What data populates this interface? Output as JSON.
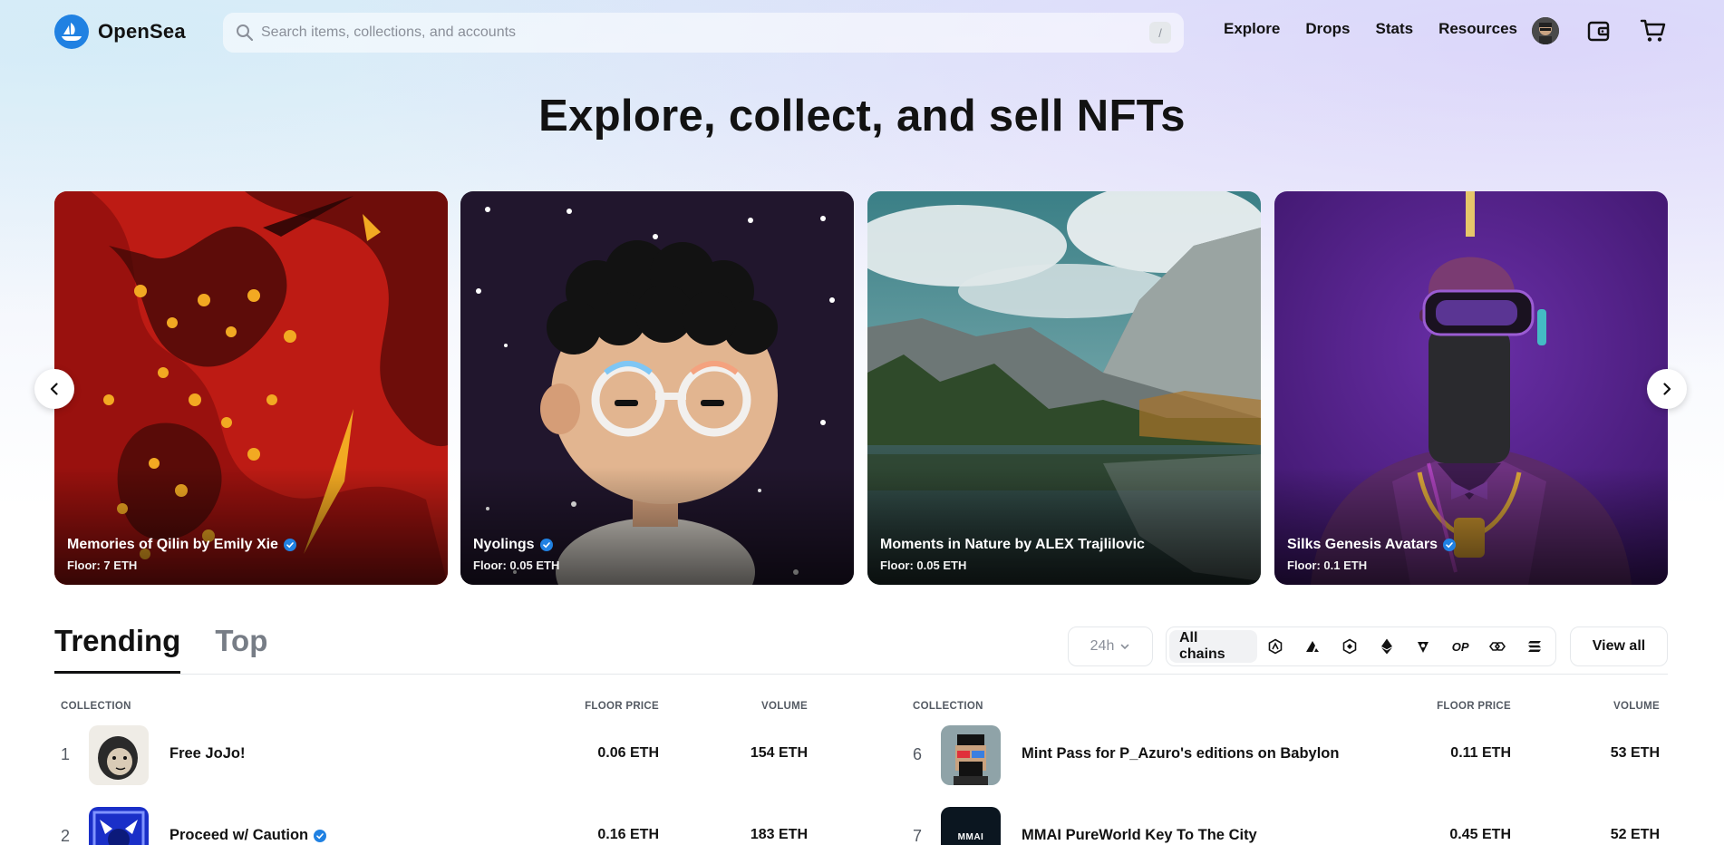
{
  "brand": {
    "name": "OpenSea"
  },
  "search": {
    "placeholder": "Search items, collections, and accounts",
    "shortcut": "/"
  },
  "nav": {
    "links": [
      "Explore",
      "Drops",
      "Stats",
      "Resources"
    ]
  },
  "hero": {
    "title": "Explore, collect, and sell NFTs"
  },
  "carousel": [
    {
      "name": "Memories of Qilin by Emily Xie",
      "floor": "Floor: 7 ETH",
      "verified": true
    },
    {
      "name": "Nyolings",
      "floor": "Floor: 0.05 ETH",
      "verified": true
    },
    {
      "name": "Moments in Nature by ALEX Trajlilovic",
      "floor": "Floor: 0.05 ETH",
      "verified": false
    },
    {
      "name": "Silks Genesis Avatars",
      "floor": "Floor: 0.1 ETH",
      "verified": true
    }
  ],
  "tabs": {
    "trending": "Trending",
    "top": "Top"
  },
  "filters": {
    "period": "24h",
    "all_chains": "All chains",
    "chain_icons": [
      "arbitrum-icon",
      "avalanche-icon",
      "bnb-icon",
      "ethereum-icon",
      "klaytn-icon",
      "optimism-icon",
      "polygon-icon",
      "solana-icon"
    ],
    "op_text": "OP",
    "view_all": "View all"
  },
  "table": {
    "headers": {
      "collection": "COLLECTION",
      "floor": "FLOOR PRICE",
      "volume": "VOLUME"
    },
    "left": [
      {
        "rank": "1",
        "name": "Free JoJo!",
        "floor": "0.06 ETH",
        "volume": "154 ETH",
        "verified": false
      },
      {
        "rank": "2",
        "name": "Proceed w/ Caution",
        "floor": "0.16 ETH",
        "volume": "183 ETH",
        "verified": true
      }
    ],
    "right": [
      {
        "rank": "6",
        "name": "Mint Pass for P_Azuro's editions on Babylon",
        "floor": "0.11 ETH",
        "volume": "53 ETH",
        "verified": false
      },
      {
        "rank": "7",
        "name": "MMAI PureWorld Key To The City",
        "floor": "0.45 ETH",
        "volume": "52 ETH",
        "verified": false
      },
      {
        "thumb_text": "MMAI"
      }
    ]
  },
  "colors": {
    "accent": "#2081e2",
    "text": "#121212"
  }
}
